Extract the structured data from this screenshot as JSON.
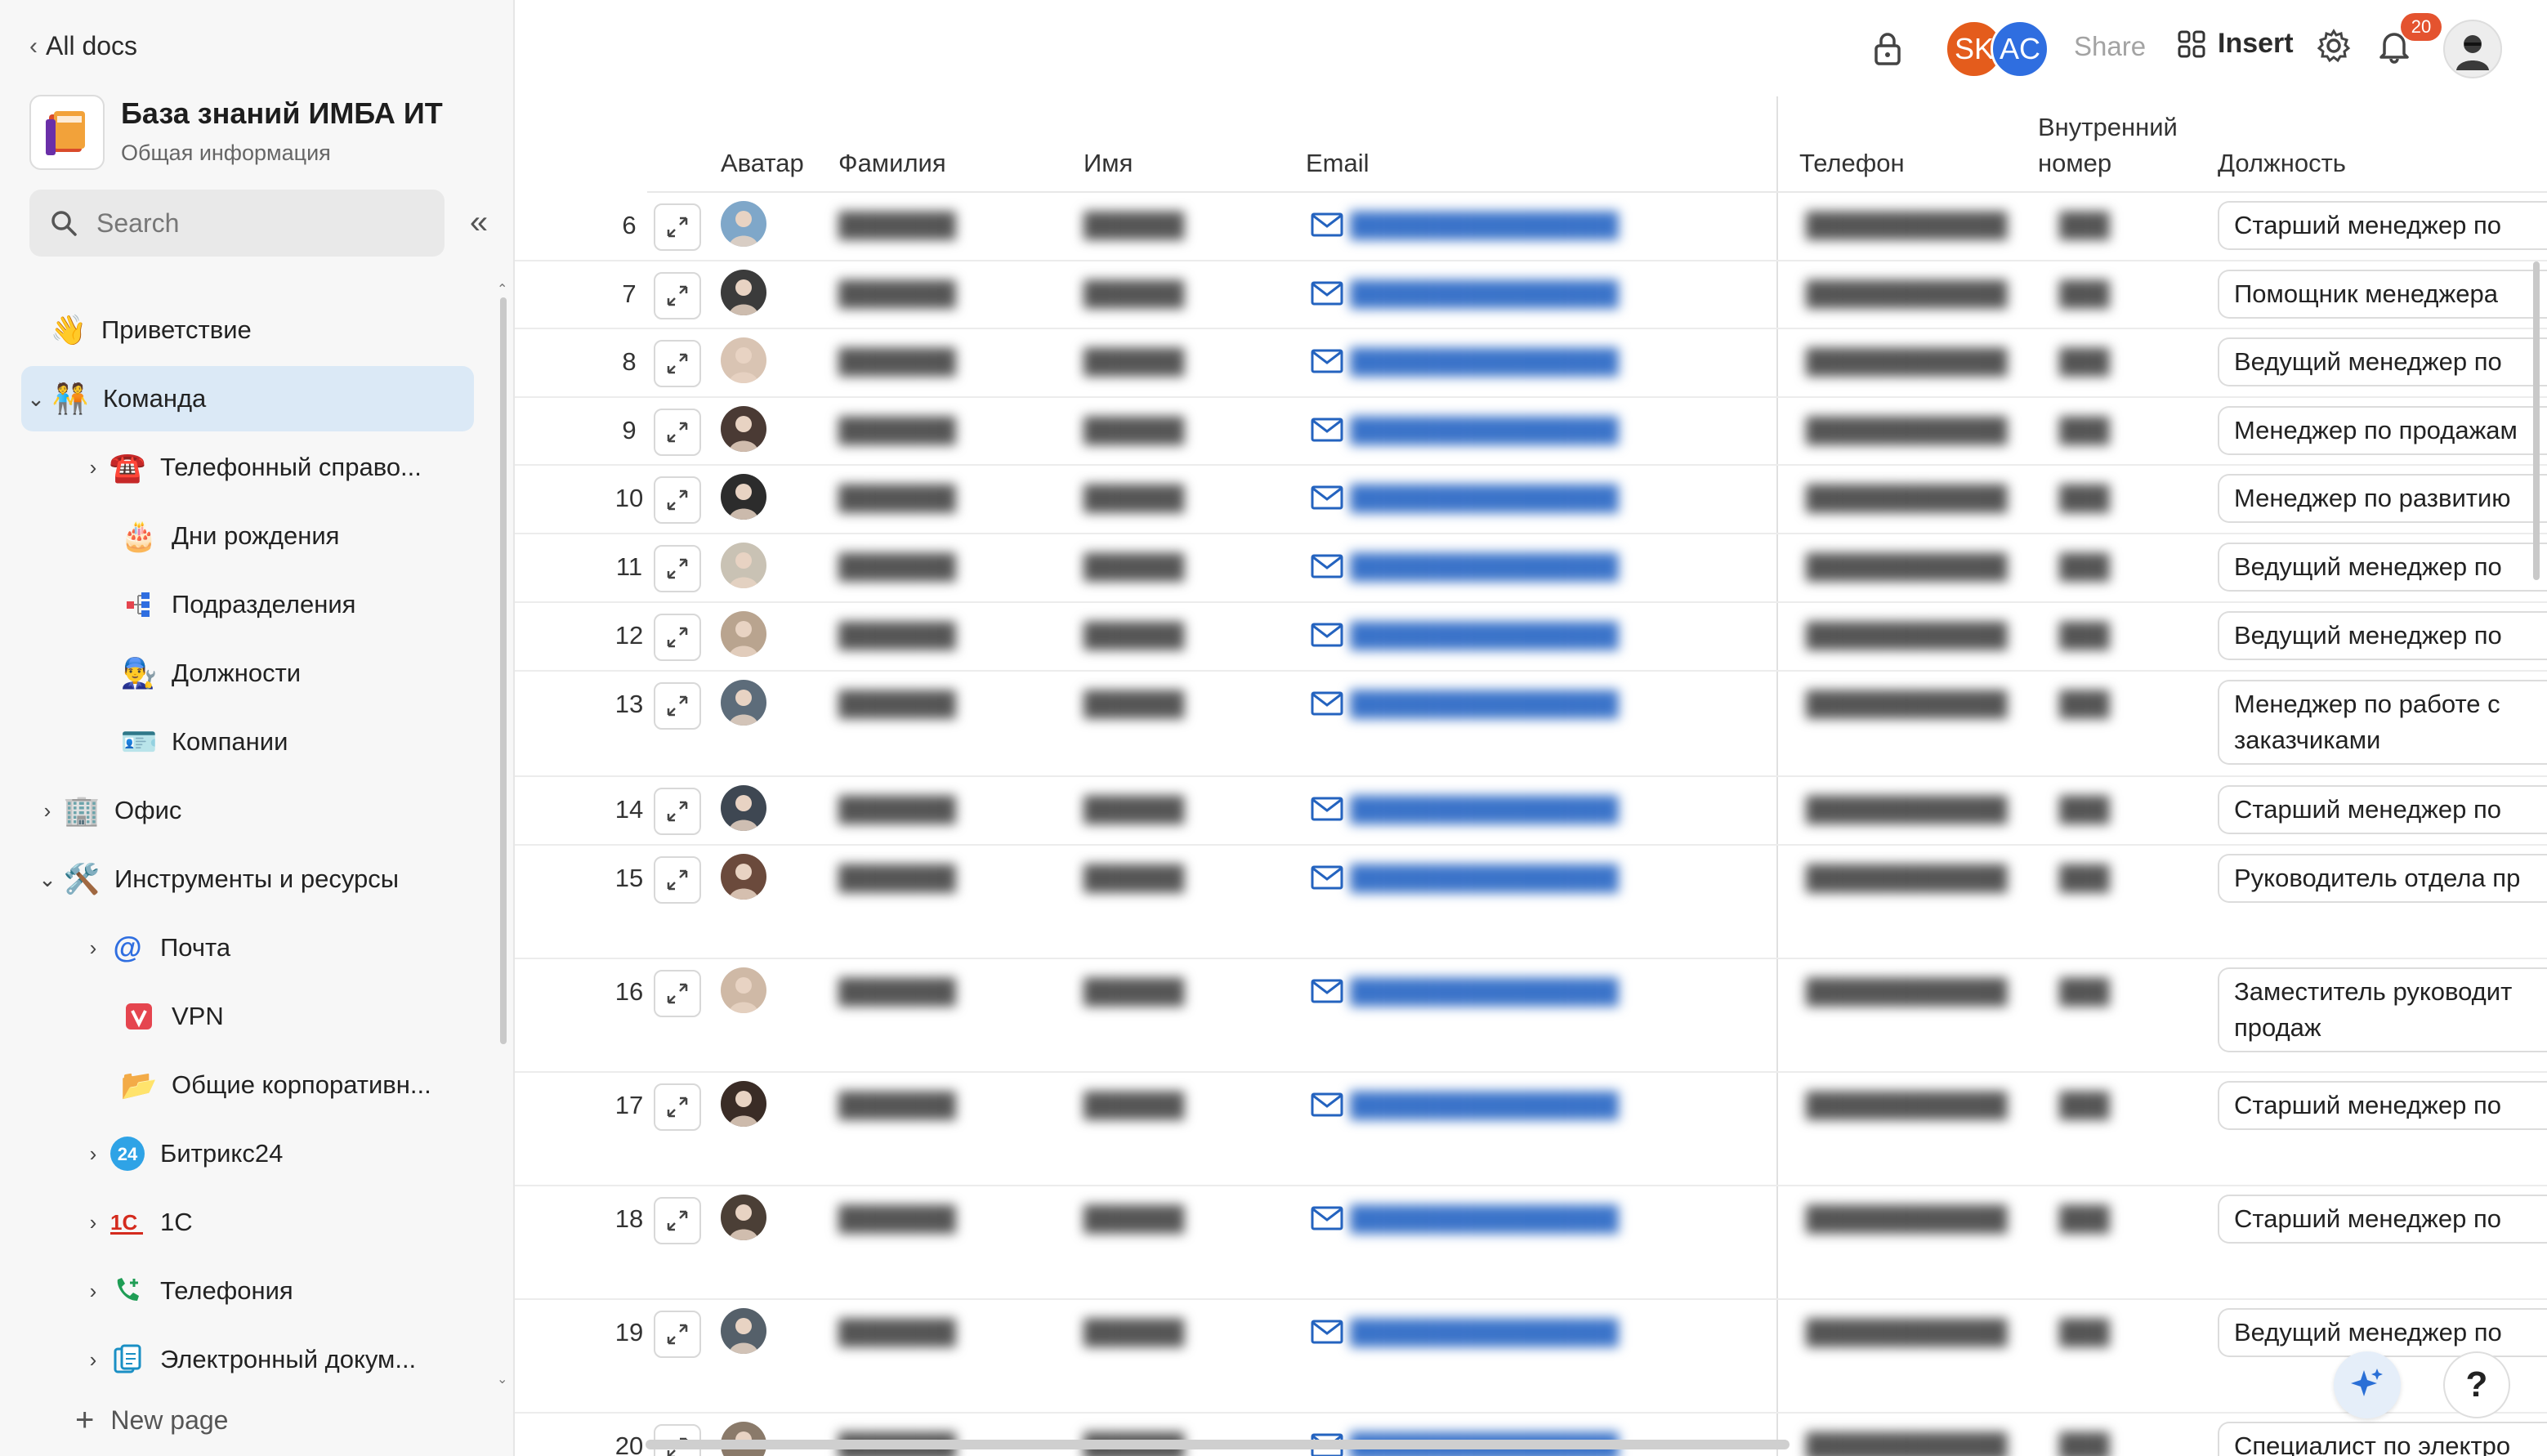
{
  "sidebar": {
    "back_label": "All docs",
    "workspace_title": "База знаний ИМБА ИТ",
    "workspace_subtitle": "Общая информация",
    "search_placeholder": "Search",
    "new_page_label": "New page",
    "items": [
      {
        "label": "Приветствие",
        "icon": "waving-hand-icon"
      },
      {
        "label": "Команда",
        "icon": "team-icon",
        "active": true
      },
      {
        "label": "Телефонный справо...",
        "icon": "telephone-icon"
      },
      {
        "label": "Дни рождения",
        "icon": "cake-icon"
      },
      {
        "label": "Подразделения",
        "icon": "org-structure-icon"
      },
      {
        "label": "Должности",
        "icon": "worker-gear-icon"
      },
      {
        "label": "Компании",
        "icon": "id-card-icon"
      },
      {
        "label": "Офис",
        "icon": "office-building-icon"
      },
      {
        "label": "Инструменты и ресурсы",
        "icon": "tools-icon"
      },
      {
        "label": "Почта",
        "icon": "at-sign-icon"
      },
      {
        "label": "VPN",
        "icon": "vpn-shield-icon"
      },
      {
        "label": "Общие корпоративн...",
        "icon": "folder-icon"
      },
      {
        "label": "Битрикс24",
        "icon": "bitrix24-icon"
      },
      {
        "label": "1С",
        "icon": "1c-icon"
      },
      {
        "label": "Телефония",
        "icon": "phone-add-icon"
      },
      {
        "label": "Электронный докум...",
        "icon": "document-flow-icon"
      }
    ]
  },
  "topbar": {
    "avatars": [
      "SK",
      "AC"
    ],
    "share_label": "Share",
    "insert_label": "Insert",
    "notifications_count": "20"
  },
  "table": {
    "headers": {
      "avatar": "Аватар",
      "lastname": "Фамилия",
      "firstname": "Имя",
      "email": "Email",
      "phone": "Телефон",
      "ext_line1": "Внутренний",
      "ext_line2": "номер",
      "position": "Должность"
    },
    "rows": [
      {
        "num": "6",
        "position": "Старший менеджер по"
      },
      {
        "num": "7",
        "position": "Помощник менеджера"
      },
      {
        "num": "8",
        "position": "Ведущий менеджер по"
      },
      {
        "num": "9",
        "position": "Менеджер по продажам"
      },
      {
        "num": "10",
        "position": "Менеджер по развитию"
      },
      {
        "num": "11",
        "position": "Ведущий менеджер по"
      },
      {
        "num": "12",
        "position": "Ведущий менеджер по"
      },
      {
        "num": "13",
        "position": "Менеджер по работе с заказчиками"
      },
      {
        "num": "14",
        "position": "Старший менеджер по"
      },
      {
        "num": "15",
        "position": "Руководитель отдела пр"
      },
      {
        "num": "16",
        "position": "Заместитель руководит продаж"
      },
      {
        "num": "17",
        "position": "Старший менеджер по"
      },
      {
        "num": "18",
        "position": "Старший менеджер по"
      },
      {
        "num": "19",
        "position": "Ведущий менеджер по"
      },
      {
        "num": "20",
        "position": "Специалист по электро"
      }
    ]
  },
  "help_label": "?"
}
